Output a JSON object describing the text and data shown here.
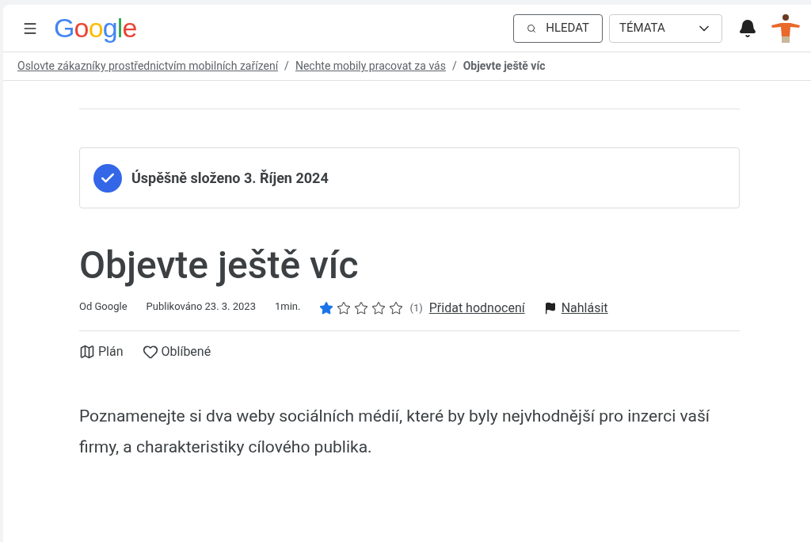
{
  "header": {
    "logo": "Google",
    "search_button": "HLEDAT",
    "topics_dropdown": "TÉMATA"
  },
  "breadcrumbs": [
    {
      "label": "Oslovte zákazníky prostřednictvím mobilních zařízení",
      "current": false
    },
    {
      "label": "Nechte mobily pracovat za vás",
      "current": false
    },
    {
      "label": "Objevte ještě víc",
      "current": true
    }
  ],
  "separator": "/",
  "completion": {
    "completed": true,
    "text": "Úspěšně složeno 3. Říjen 2024"
  },
  "title": "Objevte ještě víc",
  "meta": {
    "author": "Od Google",
    "published": "Publikováno 23. 3. 2023",
    "duration": "1min.",
    "stars": 1,
    "rating_count": "(1)",
    "rate_link": "Přidat hodnocení",
    "report_link": "Nahlásit"
  },
  "actions": [
    {
      "kind": "plan",
      "label": "Plán"
    },
    {
      "kind": "favorite",
      "label": "Oblíbené"
    }
  ],
  "body": "Poznamenejte si dva weby sociálních médií, které by byly nejvhodnější pro inzerci vaší firmy, a charakteristiky cílového publika."
}
